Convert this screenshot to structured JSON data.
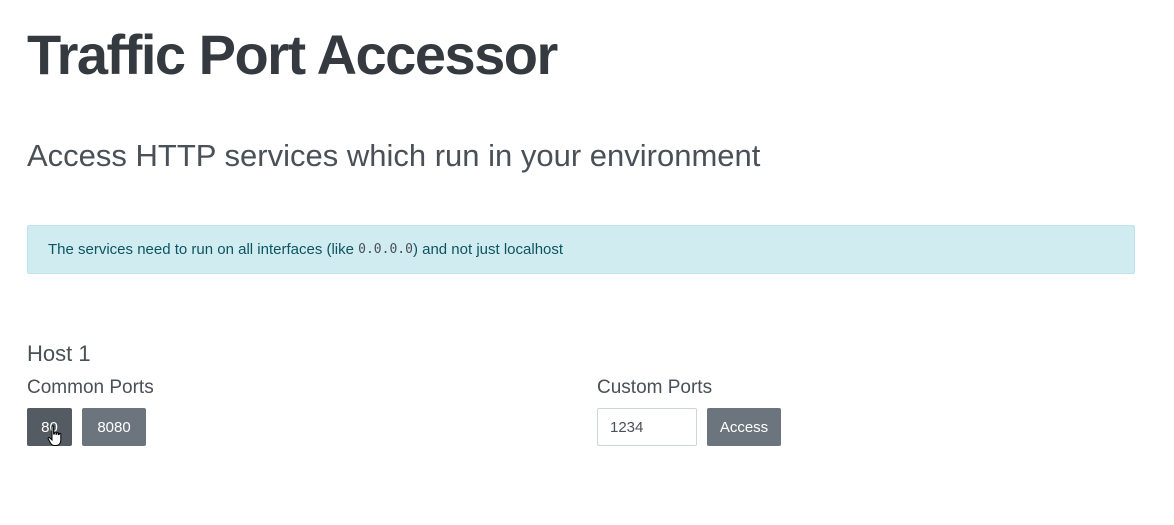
{
  "header": {
    "title": "Traffic Port Accessor",
    "subtitle": "Access HTTP services which run in your environment"
  },
  "alert": {
    "text_before": "The services need to run on all interfaces (like ",
    "code": "0.0.0.0",
    "text_after": ") and not just localhost",
    "color_background": "#d1ecf1",
    "color_text": "#0c5460"
  },
  "host": {
    "title": "Host 1",
    "common_ports_label": "Common Ports",
    "common_ports": [
      "80",
      "8080"
    ],
    "custom_ports_label": "Custom Ports",
    "custom_port_value": "1234",
    "access_label": "Access"
  },
  "colors": {
    "button": "#6c757d",
    "button_active": "#545b62",
    "text": "#343a40"
  },
  "cursor": {
    "icon": "hand-pointer-icon"
  }
}
